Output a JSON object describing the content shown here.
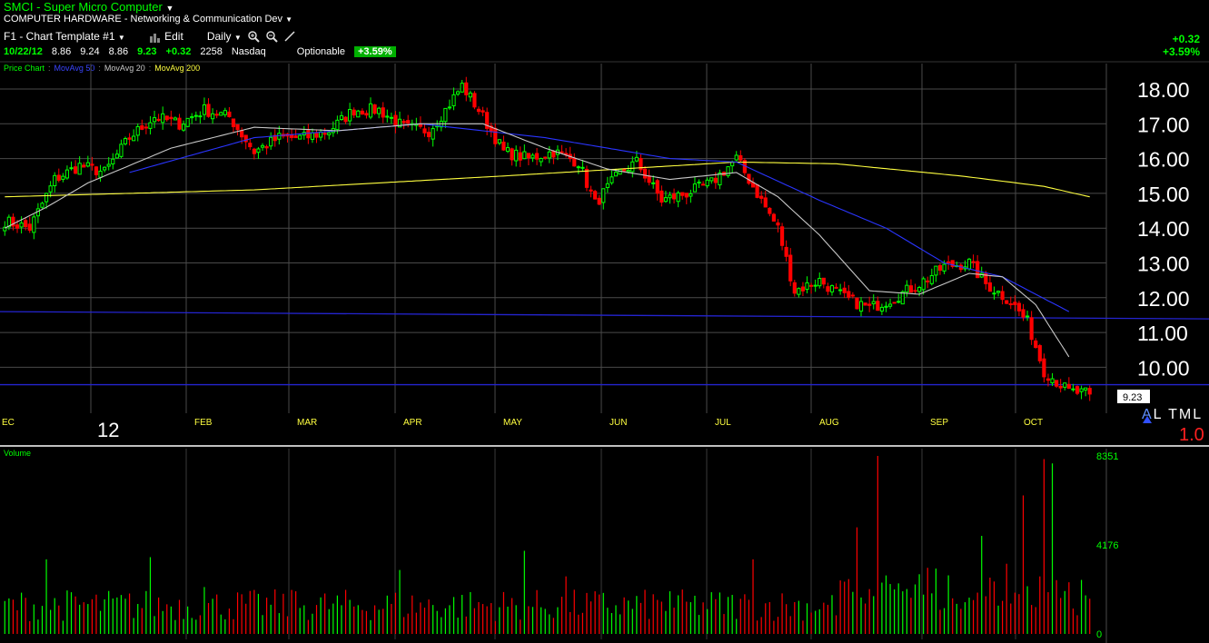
{
  "header": {
    "title": "SMCI - Super Micro Computer",
    "sector": "COMPUTER HARDWARE - Networking & Communication Dev",
    "template": "F1 - Chart Template #1",
    "edit_label": "Edit",
    "interval": "Daily"
  },
  "quote": {
    "date": "10/22/12",
    "open": "8.86",
    "high": "9.24",
    "low": "8.86",
    "last": "9.23",
    "change": "+0.32",
    "volume": "2258",
    "exchange": "Nasdaq",
    "optionable": "Optionable",
    "pct_change": "+3.59%"
  },
  "legend": {
    "price_chart": "Price Chart",
    "ma50": "MovAvg 50",
    "ma20": "MovAvg 20",
    "ma200": "MovAvg 200"
  },
  "right_summary": {
    "change": "+0.32",
    "pct": "+3.59%"
  },
  "year_label": "12",
  "tags": {
    "a": "A",
    "rest": "L TML"
  },
  "scale_value": "1.0",
  "volume_label": "Volume",
  "colors": {
    "up": "#00ff00",
    "down": "#ff0000",
    "ma50": "#2a35ff",
    "ma20": "#c8c8c8",
    "ma200": "#ffff40",
    "grid": "#4a4a4a",
    "ref_line": "#2020c0"
  },
  "chart_data": [
    {
      "type": "candlestick",
      "yticks": [
        "18.00",
        "17.00",
        "16.00",
        "15.00",
        "14.00",
        "13.00",
        "12.00",
        "11.00",
        "10.00"
      ],
      "ylim": [
        9.3,
        18.8
      ],
      "x_labels": [
        "EC",
        "FEB",
        "MAR",
        "APR",
        "MAY",
        "JUN",
        "JUL",
        "AUG",
        "SEP",
        "OCT"
      ],
      "last_price_label": "9.23",
      "anchors": [
        [
          0,
          14.2
        ],
        [
          6,
          14.0
        ],
        [
          12,
          15.4
        ],
        [
          18,
          15.8
        ],
        [
          24,
          15.6
        ],
        [
          30,
          16.6
        ],
        [
          36,
          17.2
        ],
        [
          42,
          17.0
        ],
        [
          48,
          17.4
        ],
        [
          54,
          17.2
        ],
        [
          60,
          16.2
        ],
        [
          66,
          16.6
        ],
        [
          72,
          16.6
        ],
        [
          78,
          16.8
        ],
        [
          84,
          17.4
        ],
        [
          90,
          17.4
        ],
        [
          96,
          16.9
        ],
        [
          102,
          16.8
        ],
        [
          106,
          17.4
        ],
        [
          110,
          18.1
        ],
        [
          114,
          17.4
        ],
        [
          120,
          16.2
        ],
        [
          126,
          16.0
        ],
        [
          132,
          16.2
        ],
        [
          138,
          15.9
        ],
        [
          142,
          14.7
        ],
        [
          148,
          15.6
        ],
        [
          152,
          15.9
        ],
        [
          158,
          14.8
        ],
        [
          164,
          15.0
        ],
        [
          170,
          15.3
        ],
        [
          176,
          16.0
        ],
        [
          180,
          15.2
        ],
        [
          186,
          14.0
        ],
        [
          190,
          12.2
        ],
        [
          196,
          12.5
        ],
        [
          202,
          12.0
        ],
        [
          208,
          11.7
        ],
        [
          214,
          12.0
        ],
        [
          220,
          12.4
        ],
        [
          226,
          12.9
        ],
        [
          232,
          13.0
        ],
        [
          236,
          12.4
        ],
        [
          242,
          11.9
        ],
        [
          246,
          11.3
        ],
        [
          250,
          9.9
        ],
        [
          256,
          9.3
        ],
        [
          261,
          9.23
        ]
      ],
      "ma50_anchors": [
        [
          30,
          15.6
        ],
        [
          60,
          16.6
        ],
        [
          100,
          17.0
        ],
        [
          130,
          16.6
        ],
        [
          160,
          16.0
        ],
        [
          176,
          15.9
        ],
        [
          196,
          14.8
        ],
        [
          212,
          14.0
        ],
        [
          226,
          13.0
        ],
        [
          240,
          12.6
        ],
        [
          256,
          11.6
        ]
      ],
      "ma20_anchors": [
        [
          0,
          14.0
        ],
        [
          10,
          14.6
        ],
        [
          20,
          15.3
        ],
        [
          40,
          16.3
        ],
        [
          60,
          16.9
        ],
        [
          80,
          16.8
        ],
        [
          100,
          17.0
        ],
        [
          115,
          17.0
        ],
        [
          130,
          16.3
        ],
        [
          145,
          15.7
        ],
        [
          160,
          15.4
        ],
        [
          176,
          15.6
        ],
        [
          186,
          14.9
        ],
        [
          196,
          13.8
        ],
        [
          208,
          12.2
        ],
        [
          220,
          12.1
        ],
        [
          232,
          12.7
        ],
        [
          240,
          12.6
        ],
        [
          248,
          11.8
        ],
        [
          256,
          10.3
        ]
      ],
      "ma200_anchors": [
        [
          0,
          14.9
        ],
        [
          60,
          15.1
        ],
        [
          120,
          15.5
        ],
        [
          176,
          15.9
        ],
        [
          200,
          15.85
        ],
        [
          230,
          15.5
        ],
        [
          250,
          15.2
        ],
        [
          261,
          14.9
        ]
      ],
      "ref_lines": [
        11.6,
        9.5
      ]
    },
    {
      "type": "bar",
      "title": "Volume",
      "yticks": [
        "8351",
        "4176",
        "0"
      ],
      "ylim": [
        0,
        8351
      ],
      "spikes": [
        [
          10,
          3500
        ],
        [
          35,
          3600
        ],
        [
          48,
          2200
        ],
        [
          70,
          2000
        ],
        [
          95,
          3000
        ],
        [
          125,
          3900
        ],
        [
          135,
          2700
        ],
        [
          160,
          2000
        ],
        [
          180,
          3500
        ],
        [
          205,
          5000
        ],
        [
          210,
          8351
        ],
        [
          220,
          2800
        ],
        [
          235,
          4600
        ],
        [
          245,
          6500
        ],
        [
          250,
          8200
        ],
        [
          252,
          8000
        ]
      ]
    }
  ]
}
